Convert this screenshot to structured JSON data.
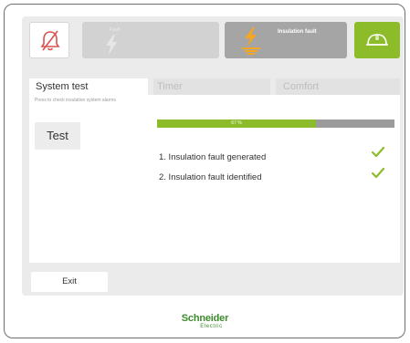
{
  "topbar": {
    "alarm_mute_icon": "bell-slash-icon",
    "fault_small_label": "Fault",
    "fault_icon": "lightning-ground-icon",
    "insulation_fault_label": "Insulation fault",
    "helmet_icon": "helmet-icon"
  },
  "tabs": [
    {
      "label": "System test",
      "active": true
    },
    {
      "label": "Timer",
      "active": false
    },
    {
      "label": "Comfort",
      "active": false
    }
  ],
  "system_test": {
    "hint": "Press to check insulation system alarms",
    "test_button": "Test",
    "progress_percent": 67,
    "progress_label": "67 %",
    "steps": [
      {
        "label": "1. Insulation fault generated",
        "status": "check-icon"
      },
      {
        "label": "2. Insulation fault identified",
        "status": "check-icon"
      }
    ]
  },
  "exit_button": "Exit",
  "branding": {
    "name": "Schneider",
    "sub": "Electric"
  },
  "colors": {
    "accent_green": "#8dbc2a",
    "fault_orange": "#f5a623",
    "alarm_red": "#d9534f"
  }
}
